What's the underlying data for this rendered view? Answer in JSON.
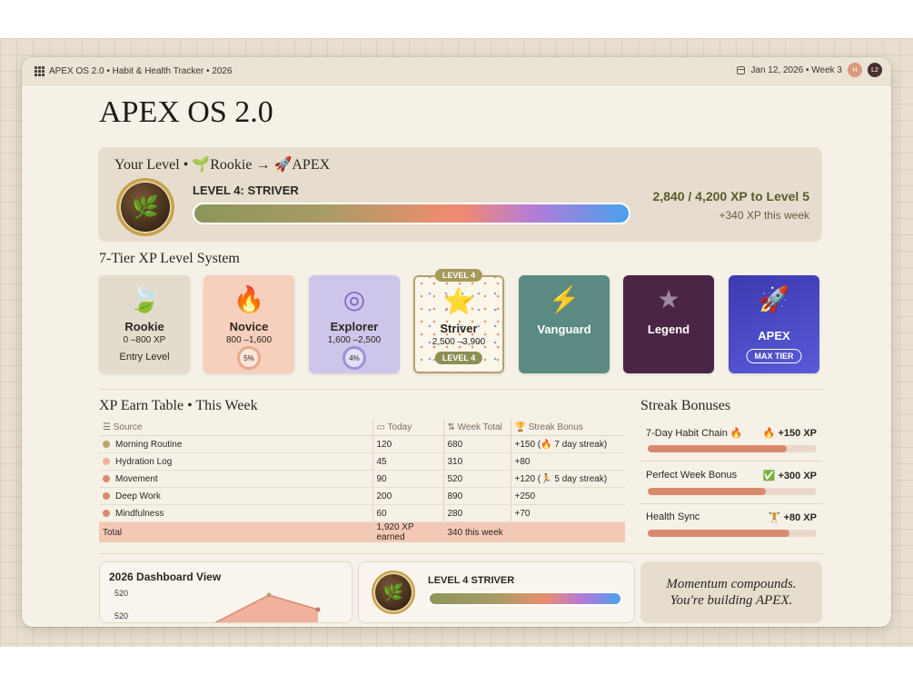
{
  "window": {
    "breadcrumb": "APEX OS 2.0 • Habit & Health Tracker • 2026",
    "date": "Jan 12, 2026 • Week 3",
    "avatars": [
      "H",
      "L2"
    ]
  },
  "page_title": "APEX OS 2.0",
  "level_card": {
    "header": "Your Level • 🌱Rookie → 🚀APEX",
    "level_name": "LEVEL 4: STRIVER",
    "xp_progress": "2,840 / 4,200 XP to Level 5",
    "xp_week": "+340 XP this week",
    "progress_fraction": 0.676
  },
  "tiers_title": "7-Tier XP Level System",
  "tiers": [
    {
      "icon": "🍃",
      "name": "Rookie",
      "range": "0 –800 XP",
      "sub": "Entry Level",
      "bg": "#e3dccd",
      "color": "#2b2620"
    },
    {
      "icon": "🔥",
      "name": "Novice",
      "range": "800 –1,600",
      "ring": "5%",
      "bg": "#f6cfbd",
      "color": "#2b2620"
    },
    {
      "icon": "◎",
      "name": "Explorer",
      "range": "1,600 –2,500",
      "ring": "4%",
      "bg": "#cec5ea",
      "color": "#2b2620"
    },
    {
      "icon": "⭐",
      "name": "Striver",
      "range": "2,500 –3,900",
      "tag": "LEVEL 4",
      "pill": "LEVEL 4",
      "bg": "#fbf6ea",
      "color": "#2b2620"
    },
    {
      "icon": "⚡",
      "name": "Vanguard",
      "bg": "#5a8a82",
      "color": "#ffffff"
    },
    {
      "icon": "★",
      "name": "Legend",
      "bg": "#4a2545",
      "color": "#ffffff"
    },
    {
      "icon": "🚀",
      "name": "APEX",
      "pill": "MAX TIER",
      "bg": "#4147bf",
      "color": "#ffffff"
    }
  ],
  "earn_table": {
    "title": "XP Earn Table • This Week",
    "columns": [
      "Source",
      "Today",
      "Week Total",
      "Streak Bonus"
    ],
    "rows": [
      {
        "source": "Morning Routine",
        "today": "120",
        "week": "680",
        "bonus": "+150 (🔥 7 day streak)",
        "dot": "#b6a772"
      },
      {
        "source": "Hydration Log",
        "today": "45",
        "week": "310",
        "bonus": "+80",
        "dot": "#ebb59d"
      },
      {
        "source": "Movement",
        "today": "90",
        "week": "520",
        "bonus": "+120 (🏃 5 day streak)",
        "dot": "#d98a6e"
      },
      {
        "source": "Deep Work",
        "today": "200",
        "week": "890",
        "bonus": "+250",
        "dot": "#d98a6e"
      },
      {
        "source": "Mindfulness",
        "today": "60",
        "week": "280",
        "bonus": "+70",
        "dot": "#d98a6e"
      }
    ],
    "total": {
      "label": "Total",
      "today": "1,920 XP earned",
      "week": "340 this week",
      "bonus": ""
    }
  },
  "streaks": {
    "title": "Streak Bonuses",
    "items": [
      {
        "label": "7-Day Habit Chain 🔥",
        "value": "🔥 +150 XP",
        "fill": 0.82
      },
      {
        "label": "Perfect Week Bonus",
        "value": "✅ +300 XP",
        "fill": 0.7
      },
      {
        "label": "Health Sync",
        "value": "🏋 +80 XP",
        "fill": 0.84
      }
    ]
  },
  "dashboard": {
    "title": "2026 Dashboard View",
    "ticks": [
      "520",
      "520"
    ]
  },
  "mini_level": {
    "label": "LEVEL 4 STRIVER"
  },
  "quote": {
    "line1": "Momentum compounds.",
    "line2": "You're building APEX."
  }
}
